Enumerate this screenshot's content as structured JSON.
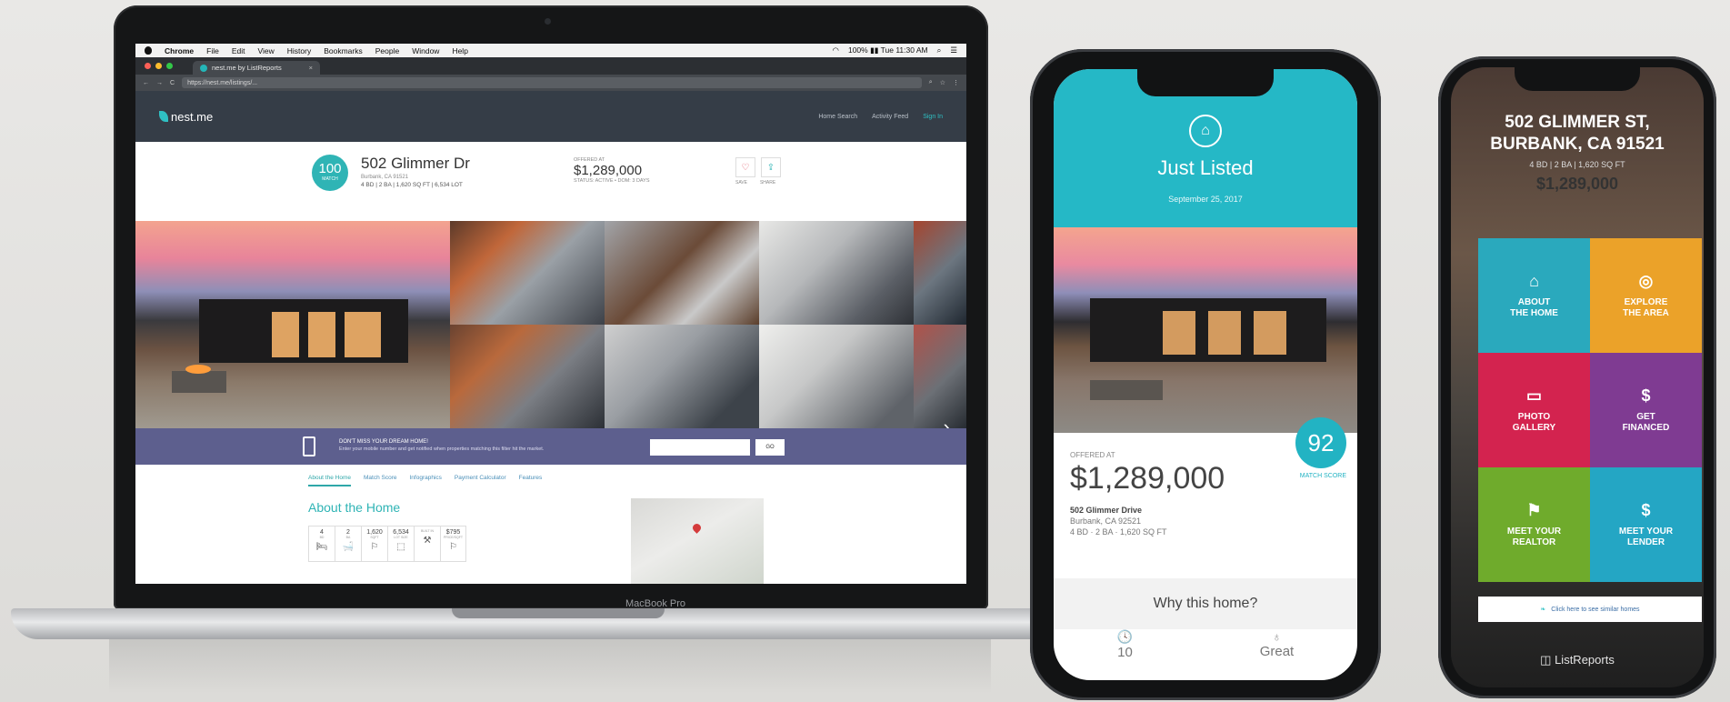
{
  "laptop": {
    "device_label": "MacBook Pro",
    "menubar": {
      "items": [
        "Chrome",
        "File",
        "Edit",
        "View",
        "History",
        "Bookmarks",
        "People",
        "Window",
        "Help"
      ],
      "status": "100% ▮▮  Tue 11:30 AM"
    },
    "browser": {
      "tab_title": "nest.me by ListReports",
      "url": "https://nest.me/listings/..."
    },
    "site": {
      "logo": "nest.me",
      "nav": [
        "Home Search",
        "Activity Feed",
        "Sign In"
      ]
    },
    "listing": {
      "score": "100",
      "score_label": "MATCH",
      "address": "502 Glimmer Dr",
      "city": "Burbank, CA 91521",
      "meta": "4 BD | 2 BA | 1,620 SQ FT | 6,534 LOT",
      "offered_label": "OFFERED AT",
      "price": "$1,289,000",
      "status": "STATUS: ACTIVE • DOM: 3 DAYS",
      "save_label": "SAVE",
      "share_label": "SHARE"
    },
    "signup": {
      "title": "DON'T MISS YOUR DREAM HOME!",
      "subtitle": "Enter your mobile number and get notified when properties matching this filter hit the market.",
      "go_label": "GO"
    },
    "tabs": [
      "About the Home",
      "Match Score",
      "Infographics",
      "Payment Calculator",
      "Features"
    ],
    "about_title": "About the Home",
    "facts": [
      {
        "value": "4",
        "label": "BD",
        "icon": "🛏"
      },
      {
        "value": "2",
        "label": "BA",
        "icon": "🛁"
      },
      {
        "value": "1,620",
        "label": "SQFT",
        "icon": "⚐"
      },
      {
        "value": "6,534",
        "label": "LOT SIZE",
        "icon": "⬚"
      },
      {
        "value": "",
        "label": "BUILT IN",
        "icon": "⚒"
      },
      {
        "value": "$795",
        "label": "PRICE/SQFT",
        "icon": "⚐"
      }
    ]
  },
  "phone1": {
    "header_title": "Just Listed",
    "date": "September 25, 2017",
    "score": "92",
    "score_label": "MATCH SCORE",
    "offered_label": "OFFERED AT",
    "price": "$1,289,000",
    "address": "502 Glimmer Drive",
    "city": "Burbank, CA 92521",
    "meta": "4 BD · 2 BA · 1,620 SQ FT",
    "why_title": "Why this home?",
    "bottom": [
      {
        "icon": "🕓",
        "value": "10"
      },
      {
        "icon": "♁",
        "value": "Great"
      }
    ]
  },
  "phone2": {
    "address_l1": "502 GLIMMER ST,",
    "address_l2": "BURBANK, CA 91521",
    "meta": "4 BD | 2 BA | 1,620 SQ FT",
    "price": "$1,289,000",
    "tiles": [
      {
        "label": "ABOUT\nTHE HOME",
        "icon": "⌂"
      },
      {
        "label": "EXPLORE\nTHE AREA",
        "icon": "◎"
      },
      {
        "label": "PHOTO\nGALLERY",
        "icon": "▭"
      },
      {
        "label": "GET\nFINANCED",
        "icon": "$"
      },
      {
        "label": "MEET YOUR\nREALTOR",
        "icon": "⚑"
      },
      {
        "label": "MEET YOUR\nLENDER",
        "icon": "$"
      }
    ],
    "link_text": "Click here to see similar homes",
    "brand": "ListReports"
  },
  "colors": {
    "teal": "#25b8c6",
    "header_dark": "#353d47",
    "signup_purple": "#5d5f8e",
    "tile_blue": "#2aa9bd",
    "tile_orange": "#eba229",
    "tile_red": "#d3234f",
    "tile_purple": "#7f3b92",
    "tile_green": "#6fab2c"
  }
}
